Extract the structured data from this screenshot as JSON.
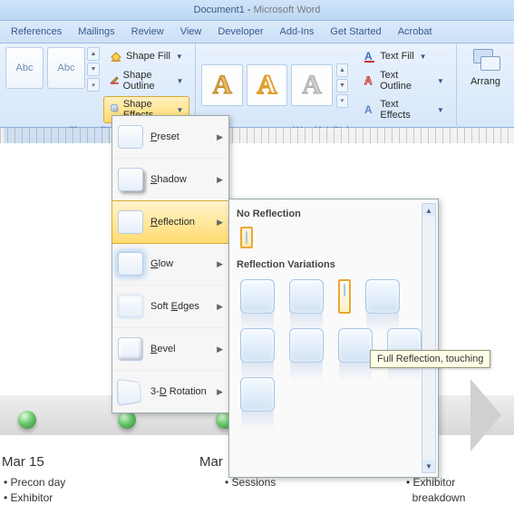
{
  "title": {
    "doc": "Document1",
    "sep": " - ",
    "app": "Microsoft Word"
  },
  "tabs": [
    "References",
    "Mailings",
    "Review",
    "View",
    "Developer",
    "Add-Ins",
    "Get Started",
    "Acrobat"
  ],
  "ribbon": {
    "shapeStyles": {
      "label": "Shape Styles",
      "thumbs": [
        "Abc",
        "Abc"
      ],
      "fill": "Shape Fill",
      "outline": "Shape Outline",
      "effects": "Shape Effects"
    },
    "wordart": {
      "label": "WordArt Styles",
      "textFill": "Text Fill",
      "textOutline": "Text Outline",
      "textEffects": "Text Effects"
    },
    "arrange": "Arrang"
  },
  "effectsMenu": {
    "items": [
      {
        "label": "Preset",
        "key": "P"
      },
      {
        "label": "Shadow",
        "key": "S"
      },
      {
        "label": "Reflection",
        "key": "R",
        "active": true
      },
      {
        "label": "Glow",
        "key": "G"
      },
      {
        "label": "Soft Edges",
        "key": "E"
      },
      {
        "label": "Bevel",
        "key": "B"
      },
      {
        "label": "3-D Rotation",
        "key": "D"
      }
    ]
  },
  "reflectionPanel": {
    "noReflection": "No Reflection",
    "variations": "Reflection Variations",
    "tooltip": "Full Reflection, touching"
  },
  "document": {
    "partialLetter": "M",
    "partialBullet": "•",
    "date1": "Mar 15",
    "date2": "Mar",
    "col1": [
      "Precon day",
      "Exhibitor"
    ],
    "col2": [
      "Sessions"
    ],
    "col3": [
      "Exhibitor",
      "breakdown"
    ]
  }
}
